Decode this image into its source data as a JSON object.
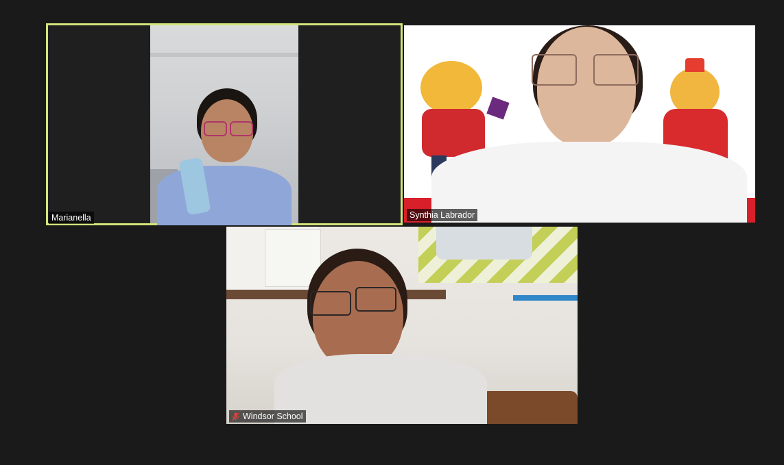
{
  "participants": [
    {
      "name": "Marianella",
      "active_speaker": true,
      "muted": false
    },
    {
      "name": "Synthia Labrador",
      "active_speaker": false,
      "muted": false
    },
    {
      "name": "Windsor School",
      "active_speaker": false,
      "muted": true
    }
  ],
  "colors": {
    "background": "#1a1a1a",
    "active_speaker_border": "#d4e57a",
    "muted_icon": "#e0403a"
  },
  "icons": {
    "muted": "mic-muted-icon"
  }
}
